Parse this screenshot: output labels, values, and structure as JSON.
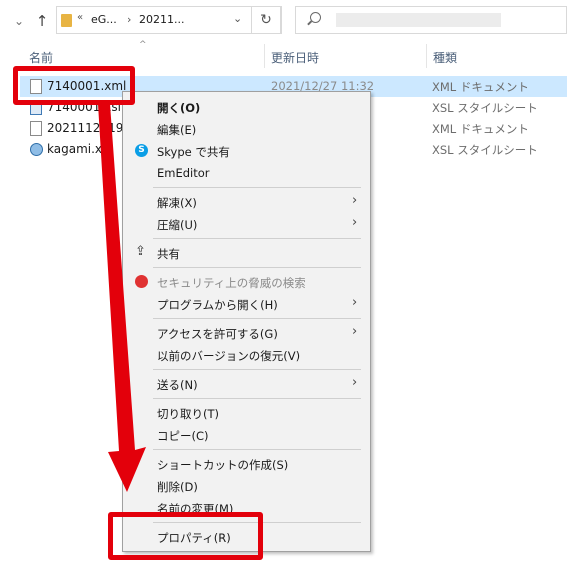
{
  "address_bar": {
    "crumb_1": "eG...",
    "crumb_2": "20211..."
  },
  "columns": {
    "name": "名前",
    "date": "更新日時",
    "type": "種類"
  },
  "files": [
    {
      "name": "7140001.xml",
      "date": "2021/12/27 11:32",
      "type": "XML ドキュメント",
      "icon": "document-icon",
      "selected": true
    },
    {
      "name": "7140001.xsl",
      "date": "",
      "type": "XSL スタイルシート",
      "icon": "xsl-file-icon",
      "selected": false
    },
    {
      "name": "20211124190499",
      "date": "",
      "type": "XML ドキュメント",
      "icon": "document-icon",
      "selected": false
    },
    {
      "name": "kagami.xsl",
      "date": "",
      "type": "XSL スタイルシート",
      "icon": "globe-file-icon",
      "selected": false
    }
  ],
  "context_menu": {
    "open": "開く(O)",
    "edit": "編集(E)",
    "skype_share": "Skype で共有",
    "emeditor": "EmEditor",
    "extract": "解凍(X)",
    "compress": "圧縮(U)",
    "share": "共有",
    "security_scan": "セキュリティ上の脅威の検索",
    "open_with": "プログラムから開く(H)",
    "grant_access": "アクセスを許可する(G)",
    "restore_versions": "以前のバージョンの復元(V)",
    "send_to": "送る(N)",
    "cut": "切り取り(T)",
    "copy": "コピー(C)",
    "create_shortcut": "ショートカットの作成(S)",
    "delete": "削除(D)",
    "rename": "名前の変更(M)",
    "properties": "プロパティ(R)"
  },
  "colors": {
    "selection": "#cce8ff",
    "annotation_red": "#e3000b",
    "menu_bg": "#f2f2f2"
  }
}
